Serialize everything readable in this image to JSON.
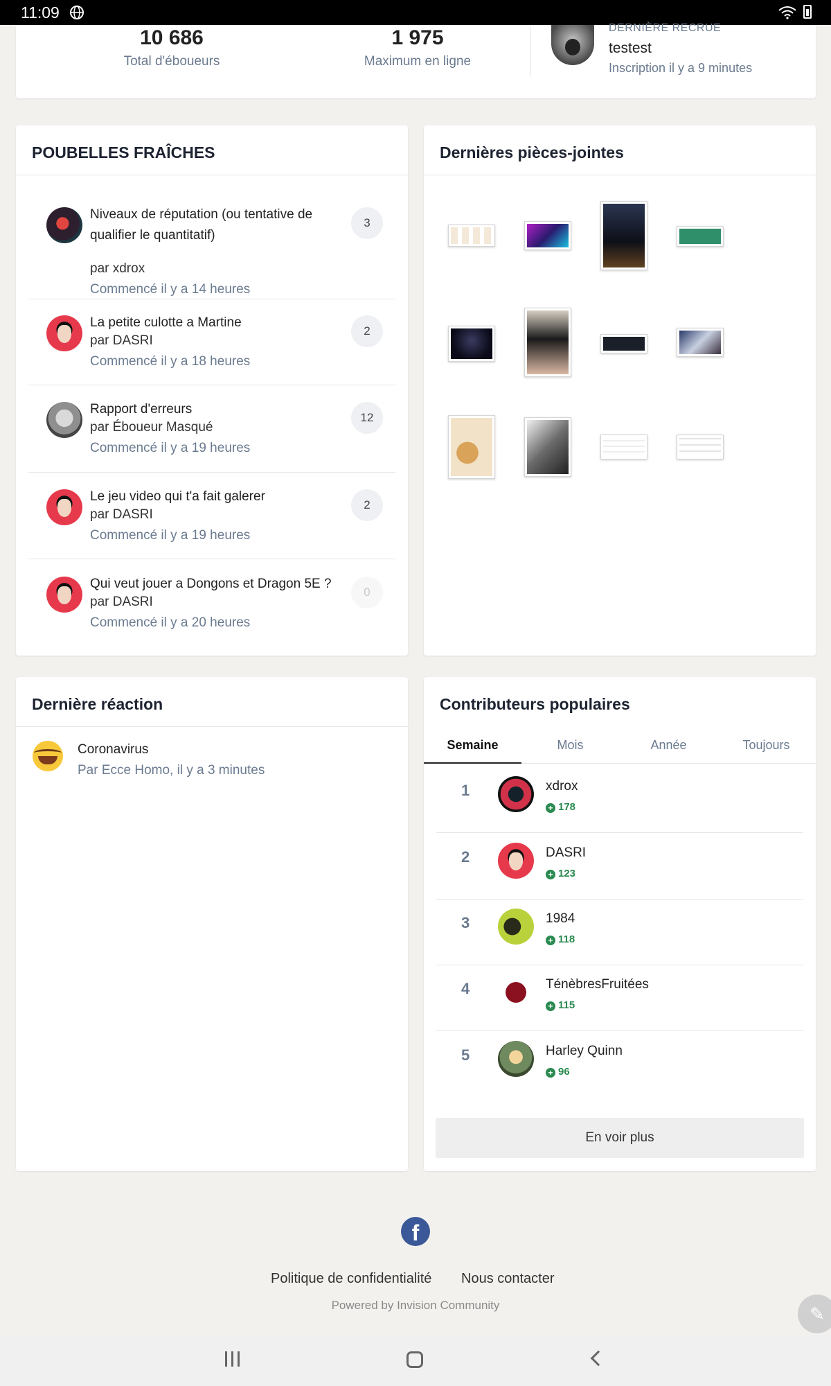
{
  "statusbar": {
    "time": "11:09"
  },
  "stats": {
    "total_value": "10 686",
    "total_label": "Total d'éboueurs",
    "max_value": "1 975",
    "max_label": "Maximum en ligne",
    "recruit_label": "DERNIÈRE RECRUE",
    "recruit_name": "testest",
    "recruit_time": "Inscription il y a 9 minutes"
  },
  "topics": {
    "title": "POUBELLES FRAÎCHES",
    "items": [
      {
        "title": "Niveaux de réputation (ou tentative de qualifier le quantitatif)",
        "by": "par xdrox",
        "when": "Commencé il y a 14 heures",
        "count": "3"
      },
      {
        "title": "La petite culotte a Martine",
        "by": "par DASRI",
        "when": "Commencé il y a 18 heures",
        "count": "2"
      },
      {
        "title": "Rapport d'erreurs",
        "by": "par Éboueur Masqué",
        "when": "Commencé il y a 19 heures",
        "count": "12"
      },
      {
        "title": "Le jeu video qui t'a fait galerer",
        "by": "par DASRI",
        "when": "Commencé il y a 19 heures",
        "count": "2"
      },
      {
        "title": "Qui veut jouer a Dongons et Dragon 5E ?",
        "by": "par DASRI",
        "when": "Commencé il y a 20 heures",
        "count": "0"
      }
    ]
  },
  "attachments": {
    "title": "Dernières pièces-jointes"
  },
  "reaction": {
    "title": "Dernière réaction",
    "item_title": "Coronavirus",
    "item_by": "Par Ecce Homo, il y a 3 minutes"
  },
  "contributors": {
    "title": "Contributeurs populaires",
    "tabs": [
      "Semaine",
      "Mois",
      "Année",
      "Toujours"
    ],
    "active_tab": "Semaine",
    "leaders": [
      {
        "rank": "1",
        "name": "xdrox",
        "score": "178"
      },
      {
        "rank": "2",
        "name": "DASRI",
        "score": "123"
      },
      {
        "rank": "3",
        "name": "1984",
        "score": "118"
      },
      {
        "rank": "4",
        "name": "TénèbresFruitées",
        "score": "115"
      },
      {
        "rank": "5",
        "name": "Harley Quinn",
        "score": "96"
      }
    ],
    "more_label": "En voir plus"
  },
  "footer": {
    "privacy": "Politique de confidentialité",
    "contact": "Nous contacter",
    "powered": "Powered by Invision Community"
  },
  "colors": {
    "accent_green": "#2a8a4f",
    "facebook": "#3b5998",
    "muted": "#6a7a8f"
  },
  "icons": [
    "globe-icon",
    "wifi-icon",
    "battery-icon",
    "facebook-icon",
    "edit-icon",
    "plus-circle-icon"
  ]
}
